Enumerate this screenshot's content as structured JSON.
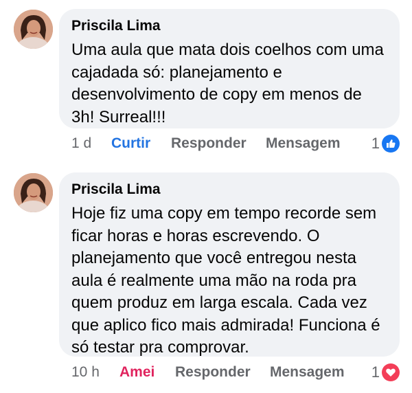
{
  "comments": [
    {
      "author": "Priscila Lima",
      "text": "Uma aula que mata dois coelhos com uma cajadada só: planejamento e desenvolvimento de copy em menos de 3h! Surreal!!!",
      "time": "1 d",
      "reaction_action": "Curtir",
      "reply_label": "Responder",
      "message_label": "Mensagem",
      "reaction_count": "1",
      "reaction_icon": "thumbs-up-icon",
      "reaction_color": "#2374e1"
    },
    {
      "author": "Priscila Lima",
      "text": "Hoje fiz uma copy em tempo recorde sem ficar horas e horas escrevendo. O planejamento que você entregou nesta aula é realmente uma mão na roda pra quem produz em larga escala. Cada vez que aplico fico mais admirada! Funciona é só testar pra comprovar.",
      "time": "10 h",
      "reaction_action": "Amei",
      "reply_label": "Responder",
      "message_label": "Mensagem",
      "reaction_count": "1",
      "reaction_icon": "heart-icon",
      "reaction_color": "#e0245e"
    }
  ]
}
